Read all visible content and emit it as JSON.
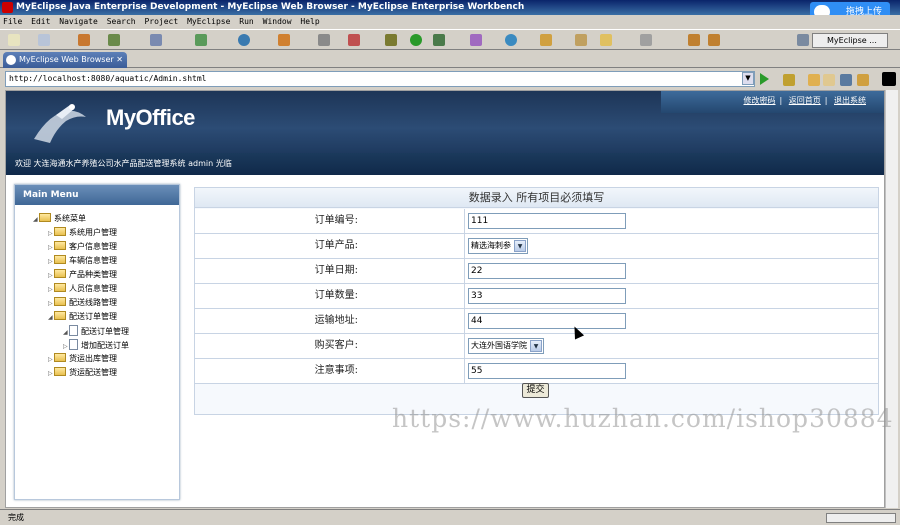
{
  "window": {
    "title": "MyEclipse Java Enterprise Development - MyEclipse Web Browser - MyEclipse Enterprise Workbench",
    "upload_label": "拖拽上传"
  },
  "menu": [
    "File",
    "Edit",
    "Navigate",
    "Search",
    "Project",
    "MyEclipse",
    "Run",
    "Window",
    "Help"
  ],
  "perspective": "MyEclipse ...",
  "editor_tab": {
    "label": "MyEclipse Web Browser",
    "close": "✕"
  },
  "address": {
    "url": "http://localhost:8080/aquatic/Admin.shtml"
  },
  "app": {
    "logo": "MyOffice",
    "top_links": [
      "修改密码",
      "返回首页",
      "退出系统"
    ],
    "welcome": "欢迎 大连海通水产养殖公司水产品配送管理系统 admin 光临"
  },
  "sidebar": {
    "header": "Main Menu",
    "root": "系统菜单",
    "items": [
      "系统用户管理",
      "客户信息管理",
      "车辆信息管理",
      "产品种类管理",
      "人员信息管理",
      "配送线路管理",
      "配送订单管理"
    ],
    "sub_items": [
      "配送订单管理",
      "增加配送订单"
    ],
    "items_after": [
      "货运出库管理",
      "货运配送管理"
    ]
  },
  "form": {
    "title": "数据录入 所有项目必须填写",
    "fields": [
      {
        "label": "订单编号:",
        "value": "111",
        "type": "text"
      },
      {
        "label": "订单产品:",
        "value": "精选海刺参",
        "type": "select"
      },
      {
        "label": "订单日期:",
        "value": "22",
        "type": "text"
      },
      {
        "label": "订单数量:",
        "value": "33",
        "type": "text"
      },
      {
        "label": "运输地址:",
        "value": "44",
        "type": "text"
      },
      {
        "label": "购买客户:",
        "value": "大连外国语学院",
        "type": "select"
      },
      {
        "label": "注意事项:",
        "value": "55",
        "type": "text"
      }
    ],
    "submit": "提交"
  },
  "watermark": "https://www.huzhan.com/ishop30884",
  "status": "完成",
  "colors": {
    "banner": "#1d3557",
    "title_bar": "#0a246a",
    "accent": "#3f6796"
  }
}
